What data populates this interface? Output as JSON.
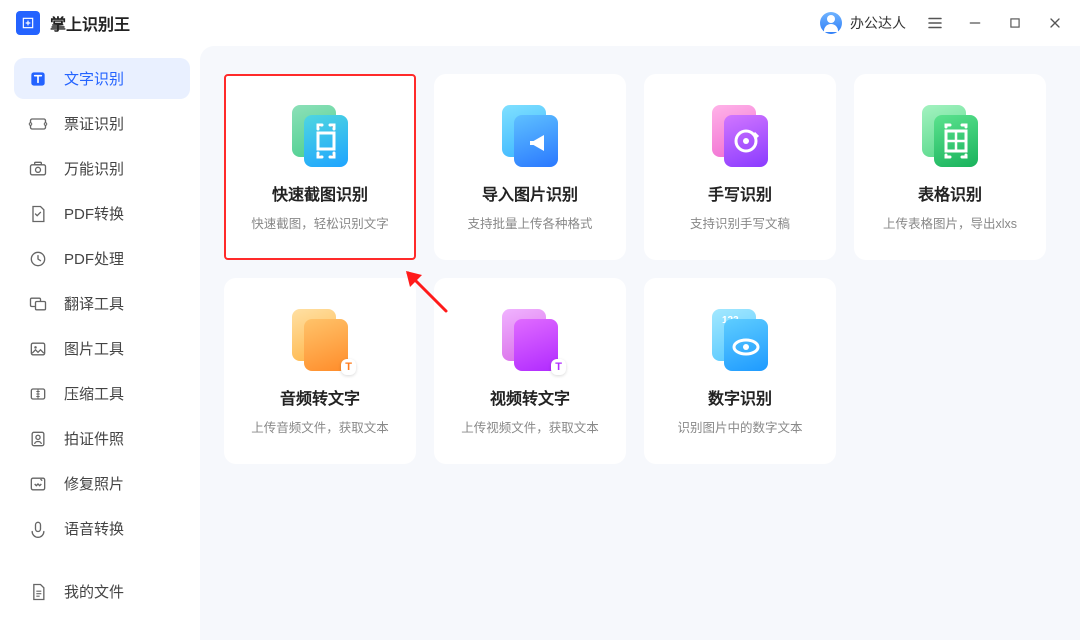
{
  "app": {
    "title": "掌上识别王"
  },
  "user": {
    "name": "办公达人"
  },
  "sidebar": {
    "items": [
      {
        "label": "文字识别"
      },
      {
        "label": "票证识别"
      },
      {
        "label": "万能识别"
      },
      {
        "label": "PDF转换"
      },
      {
        "label": "PDF处理"
      },
      {
        "label": "翻译工具"
      },
      {
        "label": "图片工具"
      },
      {
        "label": "压缩工具"
      },
      {
        "label": "拍证件照"
      },
      {
        "label": "修复照片"
      },
      {
        "label": "语音转换"
      }
    ],
    "myfiles_label": "我的文件"
  },
  "cards": [
    {
      "title": "快速截图识别",
      "desc": "快速截图，轻松识别文字"
    },
    {
      "title": "导入图片识别",
      "desc": "支持批量上传各种格式"
    },
    {
      "title": "手写识别",
      "desc": "支持识别手写文稿"
    },
    {
      "title": "表格识别",
      "desc": "上传表格图片，导出xlxs"
    },
    {
      "title": "音频转文字",
      "desc": "上传音频文件，获取文本"
    },
    {
      "title": "视频转文字",
      "desc": "上传视频文件，获取文本"
    },
    {
      "title": "数字识别",
      "desc": "识别图片中的数字文本"
    }
  ]
}
